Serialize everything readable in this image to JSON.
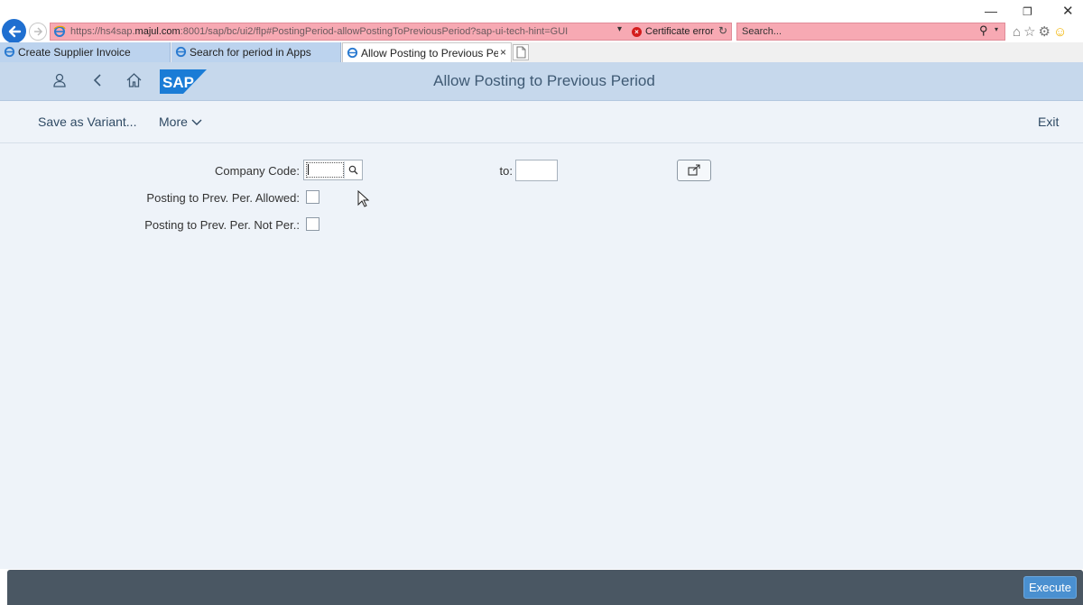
{
  "browser": {
    "url_prefix": "https://hs4sap.",
    "url_domain": "majul.com",
    "url_suffix": ":8001/sap/bc/ui2/flp#PostingPeriod-allowPostingToPreviousPeriod?sap-ui-tech-hint=GUI",
    "certificate_error": "Certificate error",
    "search_placeholder": "Search...",
    "tabs": [
      {
        "label": "Create Supplier Invoice"
      },
      {
        "label": "Search for period in Apps"
      },
      {
        "label": "Allow Posting to Previous Per..."
      }
    ],
    "colors": {
      "address_bar": "#f7a9b3",
      "tab_inactive": "#bcd3ee",
      "back_button": "#1f6fd0"
    }
  },
  "shell": {
    "title": "Allow Posting to Previous Period",
    "logo_text": "SAP",
    "colors": {
      "shell_bg": "#c6d8ec",
      "logo": "#1a7cd6"
    }
  },
  "toolbar": {
    "save_variant": "Save as Variant...",
    "more": "More",
    "exit": "Exit"
  },
  "form": {
    "company_code_label": "Company Code:",
    "company_code_value": "",
    "to_label": "to:",
    "to_value": "",
    "allowed_label": "Posting to Prev. Per. Allowed:",
    "allowed_checked": false,
    "not_permitted_label": "Posting to Prev. Per. Not Per.:",
    "not_permitted_checked": false
  },
  "footer": {
    "execute": "Execute",
    "colors": {
      "footer_bg": "#4a5763",
      "execute_bg": "#4a90d0"
    }
  }
}
